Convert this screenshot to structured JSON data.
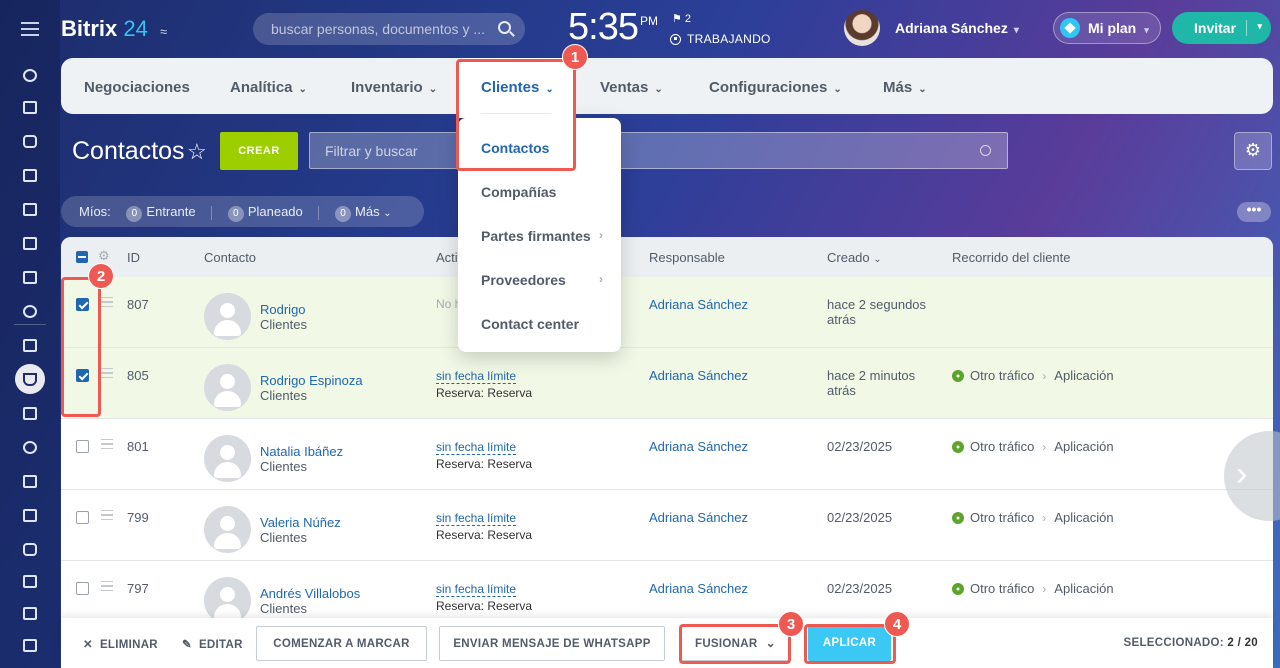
{
  "header": {
    "brand_name": "Bitrix",
    "brand_num": "24",
    "search_placeholder": "buscar personas, documentos y ...",
    "clock": "5:35",
    "clock_ampm": "PM",
    "flag_count": "2",
    "work_status": "TRABAJANDO",
    "user_name": "Adriana Sánchez",
    "plan_label": "Mi plan",
    "invite_label": "Invitar"
  },
  "topnav": {
    "items": [
      "Negociaciones",
      "Analítica",
      "Inventario",
      "Clientes",
      "Ventas",
      "Configuraciones",
      "Más"
    ]
  },
  "dropdown": {
    "items": [
      "Contactos",
      "Compañías",
      "Partes firmantes",
      "Proveedores",
      "Contact center"
    ]
  },
  "page": {
    "title": "Contactos",
    "create_label": "CREAR",
    "filter_placeholder": "Filtrar y buscar"
  },
  "counters": {
    "label": "Míos:",
    "items": [
      {
        "count": "0",
        "label": "Entrante"
      },
      {
        "count": "0",
        "label": "Planeado"
      },
      {
        "count": "0",
        "label": "Más"
      }
    ]
  },
  "grid": {
    "columns": [
      "ID",
      "Contacto",
      "Actividades",
      "Responsable",
      "Creado",
      "Recorrido del cliente"
    ],
    "rows": [
      {
        "id": "807",
        "name": "Rodrigo",
        "type": "Clientes",
        "activity": "No hay actividades",
        "activity_note": "",
        "responsible": "Adriana Sánchez",
        "created": "hace 2 segundos atrás",
        "journey_from": "",
        "journey_to": "",
        "selected": true
      },
      {
        "id": "805",
        "name": "Rodrigo Espinoza",
        "type": "Clientes",
        "activity": "sin fecha límite",
        "activity_note": "Reserva: Reserva",
        "responsible": "Adriana Sánchez",
        "created": "hace 2 minutos atrás",
        "journey_from": "Otro tráfico",
        "journey_to": "Aplicación",
        "selected": true
      },
      {
        "id": "801",
        "name": "Natalia Ibáñez",
        "type": "Clientes",
        "activity": "sin fecha límite",
        "activity_note": "Reserva: Reserva",
        "responsible": "Adriana Sánchez",
        "created": "02/23/2025",
        "journey_from": "Otro tráfico",
        "journey_to": "Aplicación",
        "selected": false
      },
      {
        "id": "799",
        "name": "Valeria Núñez",
        "type": "Clientes",
        "activity": "sin fecha límite",
        "activity_note": "Reserva: Reserva",
        "responsible": "Adriana Sánchez",
        "created": "02/23/2025",
        "journey_from": "Otro tráfico",
        "journey_to": "Aplicación",
        "selected": false
      },
      {
        "id": "797",
        "name": "Andrés Villalobos",
        "type": "Clientes",
        "activity": "sin fecha límite",
        "activity_note": "Reserva: Reserva",
        "responsible": "Adriana Sánchez",
        "created": "02/23/2025",
        "journey_from": "Otro tráfico",
        "journey_to": "Aplicación",
        "selected": false
      }
    ]
  },
  "actions": {
    "delete": "ELIMINAR",
    "edit": "EDITAR",
    "start_call": "COMENZAR A MARCAR",
    "whatsapp": "ENVIAR MENSAJE DE WHATSAPP",
    "merge": "FUSIONAR",
    "apply": "APLICAR",
    "selected_label": "SELECCIONADO:",
    "selected_value": "2 / 20"
  },
  "callouts": [
    "1",
    "2",
    "3",
    "4"
  ],
  "colors": {
    "accent_blue": "#2067b0",
    "create_green": "#9dcf00",
    "apply_cyan": "#3bc8f5",
    "invite_teal": "#1fb7a7",
    "callout_red": "#ee5a52",
    "selected_row": "#f1f8e6"
  }
}
